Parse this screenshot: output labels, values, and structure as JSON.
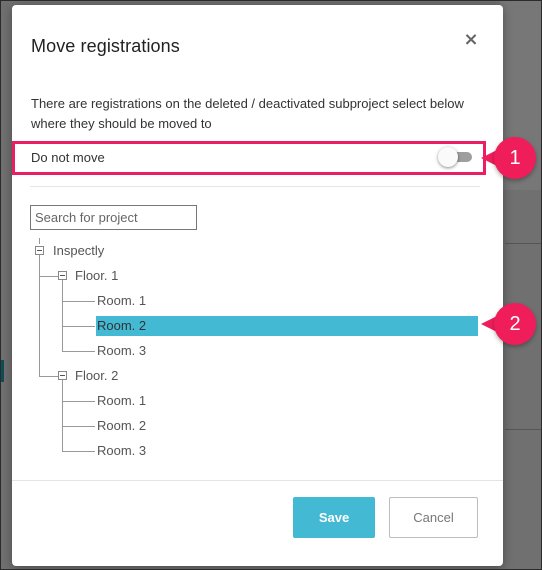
{
  "dialog": {
    "title": "Move registrations",
    "close_symbol": "×",
    "description": "There are registrations on the deleted / deactivated subproject select below where they should be moved to",
    "do_not_move_label": "Do not move",
    "do_not_move_enabled": false,
    "search_placeholder": "Search for project",
    "save_label": "Save",
    "cancel_label": "Cancel"
  },
  "tree": {
    "root": "Inspectly",
    "floors": [
      {
        "label": "Floor. 1",
        "rooms": [
          "Room. 1",
          "Room. 2",
          "Room. 3"
        ]
      },
      {
        "label": "Floor. 2",
        "rooms": [
          "Room. 1",
          "Room. 2",
          "Room. 3"
        ]
      }
    ],
    "selected": "Floor. 1 / Room. 2"
  },
  "callouts": [
    "1",
    "2"
  ],
  "colors": {
    "accent": "#44b9d3",
    "callout": "#ef1e5b",
    "highlight_border": "#e91e63"
  }
}
